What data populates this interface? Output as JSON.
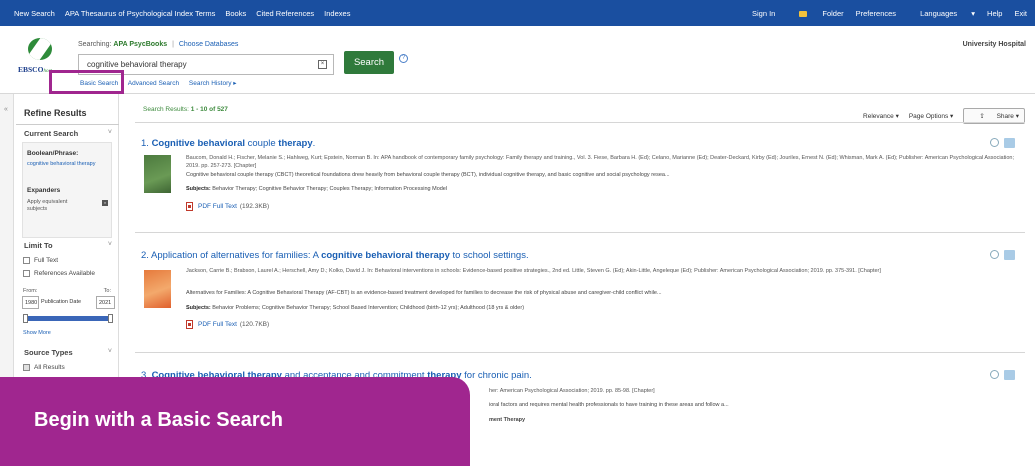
{
  "topbar": {
    "nav": [
      "New Search",
      "APA Thesaurus of Psychological Index Terms",
      "Books",
      "Cited References",
      "Indexes"
    ],
    "sign_in": "Sign In",
    "folder": "Folder",
    "preferences": "Preferences",
    "languages": "Languages",
    "help": "Help",
    "exit": "Exit"
  },
  "header": {
    "logo_text": "EBSCO",
    "logo_suffix": "host",
    "searching_label": "Searching:",
    "database": "APA PsycBooks",
    "separator": "|",
    "choose_databases": "Choose Databases",
    "query": "cognitive behavioral therapy",
    "search_button": "Search",
    "links": [
      "Basic Search",
      "Advanced Search",
      "Search History ▸"
    ],
    "institution": "University Hospital"
  },
  "sidebar": {
    "title": "Refine Results",
    "current_search": "Current Search",
    "boolean_phrase": "Boolean/Phrase:",
    "boolean_value": "cognitive behavioral therapy",
    "expanders": "Expanders",
    "expander_value": "Apply equivalent subjects",
    "limit_to": "Limit To",
    "full_text": "Full Text",
    "references_available": "References Available",
    "from": "From:",
    "to": "To:",
    "year_from": "1980",
    "publication_date": "Publication Date",
    "year_to": "2021",
    "show_more": "Show More",
    "source_types": "Source Types",
    "all_results": "All Results"
  },
  "results": {
    "label": "Search Results:",
    "range": "1 - 10 of 527",
    "relevance": "Relevance ▾",
    "page_options": "Page Options ▾",
    "share": "Share ▾",
    "items": [
      {
        "title_pre": "1. ",
        "title_b1": "Cognitive behavioral",
        "title_mid": " couple ",
        "title_b2": "therapy",
        "title_post": ".",
        "meta": "Baucom, Donald H.; Fischer, Melanie S.; Hahlweg, Kurt; Epstein, Norman B. In: APA handbook of contemporary family psychology: Family therapy and training., Vol. 3. Fiese, Barbara H. (Ed); Celano, Marianne (Ed); Deater-Deckard, Kirby (Ed); Jouriles, Ernest N. (Ed); Whisman, Mark A. (Ed); Publisher: American Psychological Association; 2019. pp. 257-273. [Chapter]",
        "description": "Cognitive behavioral couple therapy (CBCT) theoretical foundations drew heavily from behavioral couple therapy (BCT), individual cognitive therapy, and basic cognitive and social psychology resea...",
        "subjects_label": "Subjects:",
        "subjects": "Behavior Therapy; Cognitive Behavior Therapy; Couples Therapy; Information Processing Model",
        "pdf_label": "PDF Full Text",
        "pdf_size": "(192.3KB)"
      },
      {
        "title_pre": "2. Application of alternatives for families: A ",
        "title_b1": "cognitive behavioral therapy",
        "title_mid": " to school settings.",
        "meta": "Jackson, Carrie B.; Brabson, Laurel A.; Herschell, Amy D.; Kolko, David J. In: Behavioral interventions in schools: Evidence-based positive strategies., 2nd ed. Little, Steven G. (Ed); Akin-Little, Angeleque (Ed); Publisher: American Psychological Association; 2019. pp. 375-391. [Chapter]",
        "description": "Alternatives for Families: A Cognitive Behavioral Therapy (AF-CBT) is an evidence-based treatment developed for families to decrease the risk of physical abuse and caregiver-child conflict while...",
        "subjects_label": "Subjects:",
        "subjects": "Behavior Problems; Cognitive Behavior Therapy; School Based Intervention; Childhood (birth-12 yrs); Adulthood (18 yrs & older)",
        "pdf_label": "PDF Full Text",
        "pdf_size": "(120.7KB)"
      },
      {
        "title_pre": "3. ",
        "title_b1": "Cognitive behavioral therapy",
        "title_mid": " and acceptance and commitment ",
        "title_b2": "therapy",
        "title_post": " for chronic pain.",
        "meta": "her: American Psychological Association; 2019. pp. 85-98. [Chapter]",
        "description": "ioral factors and requires mental health professionals to have training in these areas and follow a...",
        "subjects": "ment Therapy"
      }
    ]
  },
  "banner": {
    "text": "Begin with a Basic Search"
  },
  "colors": {
    "topbar": "#1a4fa0",
    "search_button": "#2f7a3b",
    "accent": "#a0268f",
    "link": "#1a5fb4"
  }
}
